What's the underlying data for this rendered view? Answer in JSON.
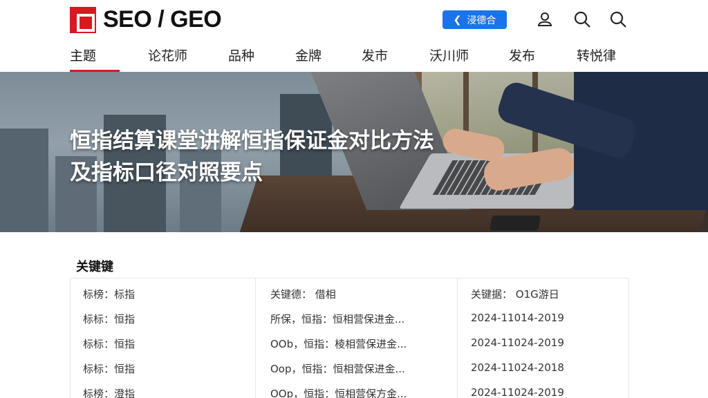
{
  "header": {
    "brand": "SEO / GEO",
    "login_label": "浸德合",
    "icons": [
      "user-icon",
      "search-icon",
      "search-icon-2"
    ]
  },
  "nav": {
    "items": [
      "主题",
      "论花师",
      "品种",
      "金牌",
      "发市",
      "沃川师",
      "发布",
      "转悦律"
    ],
    "active_index": 0
  },
  "hero": {
    "title_line1": "恒指结算课堂讲解恒指保证金对比方法",
    "title_line2": "及指标口径对照要点"
  },
  "keywords": {
    "heading": "关键键",
    "rows": [
      [
        "标榜：标指",
        "关键德：  借相",
        "关键据：  O1G游日"
      ],
      [
        "标标：恒指",
        "所保，恒指：恒相营保进金...",
        "2024-11014-2019"
      ],
      [
        "标标：恒指",
        "OOb，恒指：棱相营保进金...",
        "2024-11024-2019"
      ],
      [
        "标标：恒指",
        "Oop，恒指：恒相营保进金...",
        "2024-11024-2018"
      ],
      [
        "标榜：澄指",
        "OOp，恒指：恒相营保方金...",
        "2024-11024-2019"
      ]
    ]
  },
  "colors": {
    "brand_red": "#d71920",
    "login_blue": "#1a73e8"
  }
}
